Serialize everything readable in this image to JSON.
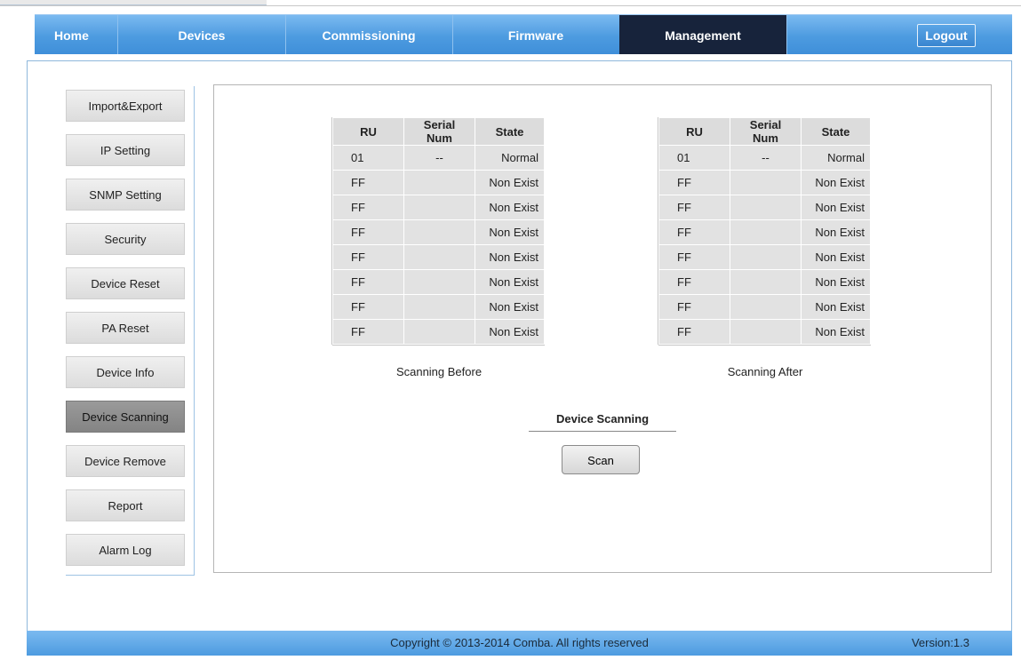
{
  "nav": {
    "items": [
      {
        "label": "Home"
      },
      {
        "label": "Devices"
      },
      {
        "label": "Commissioning"
      },
      {
        "label": "Firmware"
      },
      {
        "label": "Management",
        "active": true
      }
    ],
    "logout_label": "Logout"
  },
  "sidebar": {
    "items": [
      {
        "label": "Import&Export"
      },
      {
        "label": "IP Setting"
      },
      {
        "label": "SNMP Setting"
      },
      {
        "label": "Security"
      },
      {
        "label": "Device Reset"
      },
      {
        "label": "PA Reset"
      },
      {
        "label": "Device Info"
      },
      {
        "label": "Device Scanning",
        "active": true
      },
      {
        "label": "Device Remove"
      },
      {
        "label": "Report"
      },
      {
        "label": "Alarm Log"
      }
    ]
  },
  "tables": {
    "headers": [
      "RU",
      "Serial Num",
      "State"
    ],
    "before": {
      "caption": "Scanning Before",
      "rows": [
        [
          "01",
          "--",
          "Normal"
        ],
        [
          "FF",
          "",
          "Non Exist"
        ],
        [
          "FF",
          "",
          "Non Exist"
        ],
        [
          "FF",
          "",
          "Non Exist"
        ],
        [
          "FF",
          "",
          "Non Exist"
        ],
        [
          "FF",
          "",
          "Non Exist"
        ],
        [
          "FF",
          "",
          "Non Exist"
        ],
        [
          "FF",
          "",
          "Non Exist"
        ]
      ]
    },
    "after": {
      "caption": "Scanning After",
      "rows": [
        [
          "01",
          "--",
          "Normal"
        ],
        [
          "FF",
          "",
          "Non Exist"
        ],
        [
          "FF",
          "",
          "Non Exist"
        ],
        [
          "FF",
          "",
          "Non Exist"
        ],
        [
          "FF",
          "",
          "Non Exist"
        ],
        [
          "FF",
          "",
          "Non Exist"
        ],
        [
          "FF",
          "",
          "Non Exist"
        ],
        [
          "FF",
          "",
          "Non Exist"
        ]
      ]
    }
  },
  "scanning": {
    "title": "Device Scanning",
    "button_label": "Scan"
  },
  "footer": {
    "copyright": "Copyright © 2013-2014 Comba. All rights reserved",
    "version": "Version:1.3"
  },
  "colors": {
    "nav_blue": "#4d9be0",
    "nav_active": "#17233b",
    "sidebar_active": "#8c8c8c"
  }
}
